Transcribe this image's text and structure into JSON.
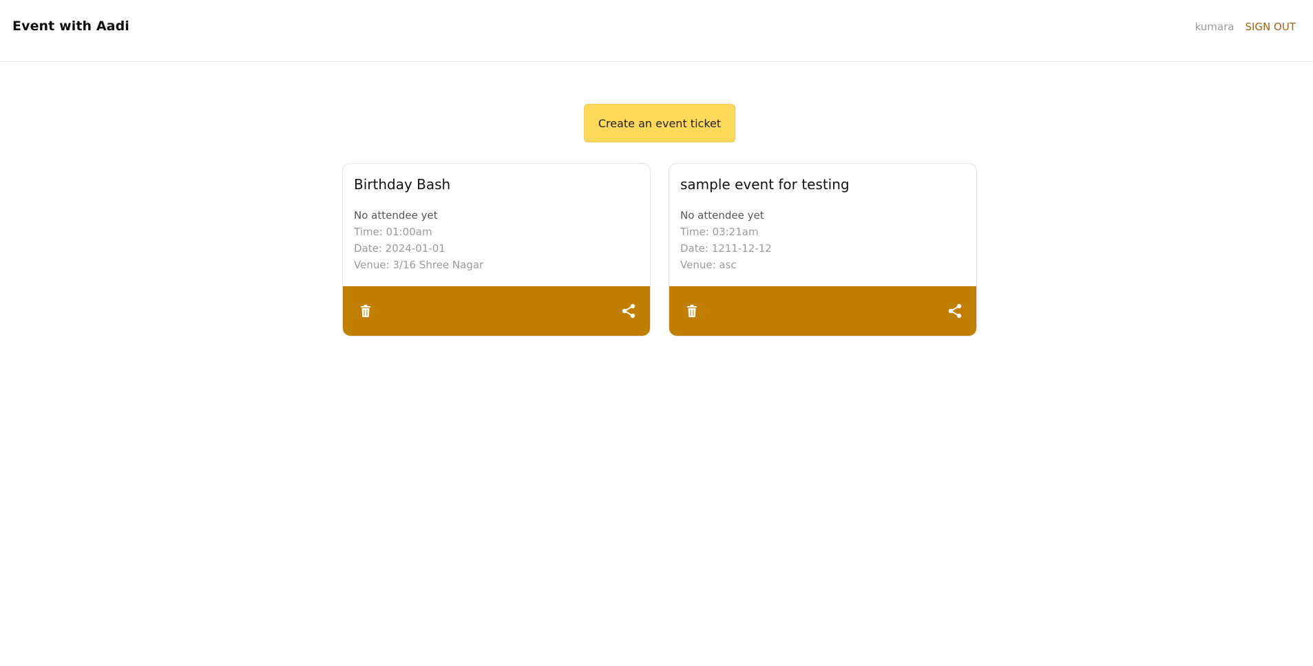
{
  "header": {
    "brand": "Event with Aadi",
    "username": "kumara",
    "signout_label": "SIGN OUT"
  },
  "actions": {
    "create_label": "Create an event ticket"
  },
  "events": [
    {
      "title": "Birthday Bash",
      "attendees": "No attendee yet",
      "time": "Time: 01:00am",
      "date": "Date: 2024-01-01",
      "venue": "Venue: 3/16 Shree Nagar"
    },
    {
      "title": "sample event for testing",
      "attendees": "No attendee yet",
      "time": "Time: 03:21am",
      "date": "Date: 1211-12-12",
      "venue": "Venue: asc"
    }
  ],
  "icons": {
    "delete": "trash-icon",
    "share": "share-icon"
  },
  "colors": {
    "accent": "#ffd95a",
    "card_footer": "#c17f00",
    "signout": "#a0641a"
  }
}
